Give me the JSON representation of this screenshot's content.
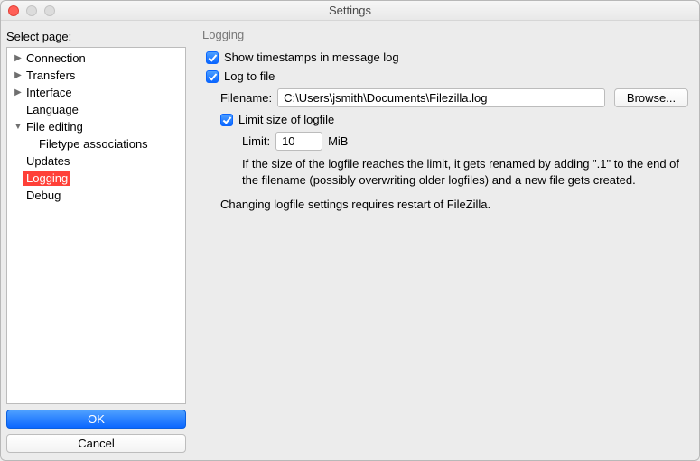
{
  "window": {
    "title": "Settings"
  },
  "sidebar": {
    "label": "Select page:",
    "items": [
      {
        "label": "Connection"
      },
      {
        "label": "Transfers"
      },
      {
        "label": "Interface"
      },
      {
        "label": "Language"
      },
      {
        "label": "File editing"
      },
      {
        "label": "Filetype associations"
      },
      {
        "label": "Updates"
      },
      {
        "label": "Logging"
      },
      {
        "label": "Debug"
      }
    ],
    "ok_label": "OK",
    "cancel_label": "Cancel"
  },
  "page": {
    "heading": "Logging",
    "show_timestamps_label": "Show timestamps in message log",
    "log_to_file_label": "Log to file",
    "filename_label": "Filename:",
    "filename_value": "C:\\Users\\jsmith\\Documents\\Filezilla.log",
    "browse_label": "Browse...",
    "limit_size_label": "Limit size of logfile",
    "limit_label": "Limit:",
    "limit_value": "10",
    "limit_unit": "MiB",
    "info1": "If the size of the logfile reaches the limit, it gets renamed by adding \".1\" to the end of the filename (possibly overwriting older logfiles) and a new file gets created.",
    "info2": "Changing logfile settings requires restart of FileZilla."
  }
}
